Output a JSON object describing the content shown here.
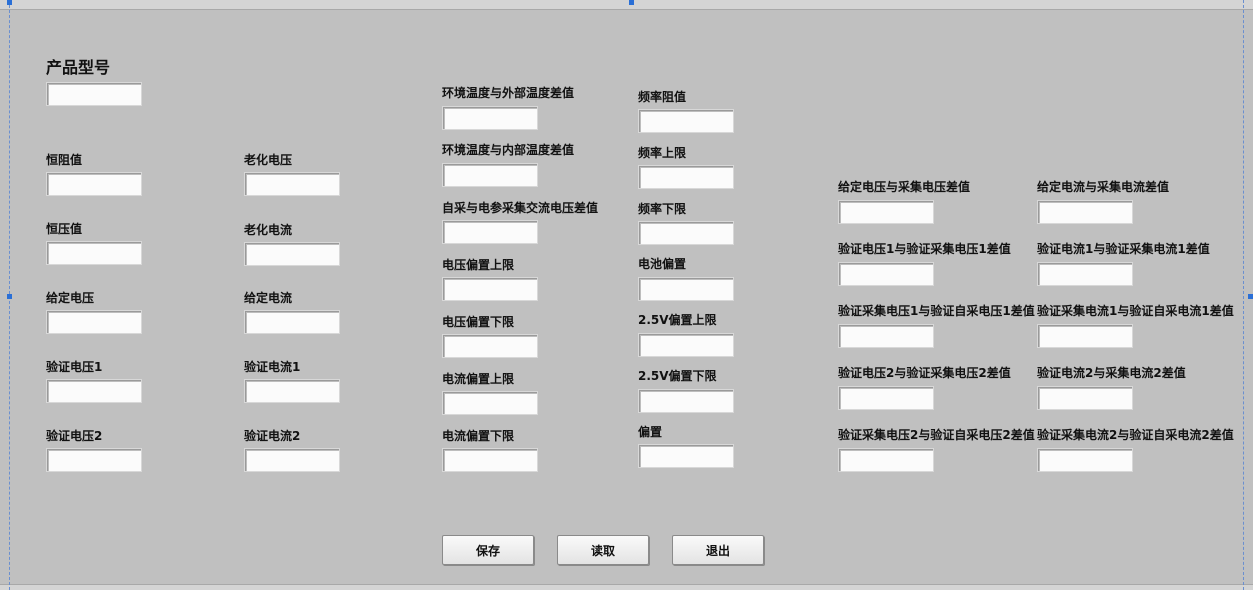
{
  "product_model": {
    "label": "产品型号",
    "value": ""
  },
  "left_fields": [
    {
      "label": "恒阻值",
      "value": ""
    },
    {
      "label": "老化电压",
      "value": ""
    },
    {
      "label": "恒压值",
      "value": ""
    },
    {
      "label": "老化电流",
      "value": ""
    },
    {
      "label": "给定电压",
      "value": ""
    },
    {
      "label": "给定电流",
      "value": ""
    },
    {
      "label": "验证电压1",
      "value": ""
    },
    {
      "label": "验证电流1",
      "value": ""
    },
    {
      "label": "验证电压2",
      "value": ""
    },
    {
      "label": "验证电流2",
      "value": ""
    }
  ],
  "mid_fields": [
    {
      "label": "环境温度与外部温度差值",
      "value": ""
    },
    {
      "label": "环境温度与内部温度差值",
      "value": ""
    },
    {
      "label": "自采与电参采集交流电压差值",
      "value": ""
    },
    {
      "label": "电压偏置上限",
      "value": ""
    },
    {
      "label": "电压偏置下限",
      "value": ""
    },
    {
      "label": "电流偏置上限",
      "value": ""
    },
    {
      "label": "电流偏置下限",
      "value": ""
    }
  ],
  "freq_fields": [
    {
      "label": "频率阻值",
      "value": ""
    },
    {
      "label": "频率上限",
      "value": ""
    },
    {
      "label": "频率下限",
      "value": ""
    },
    {
      "label": "电池偏置",
      "value": ""
    },
    {
      "label": "2.5V偏置上限",
      "value": ""
    },
    {
      "label": "2.5V偏置下限",
      "value": ""
    },
    {
      "label": "偏置",
      "value": ""
    }
  ],
  "right_fields": [
    {
      "label": "给定电压与采集电压差值",
      "value": ""
    },
    {
      "label": "给定电流与采集电流差值",
      "value": ""
    },
    {
      "label": "验证电压1与验证采集电压1差值",
      "value": ""
    },
    {
      "label": "验证电流1与验证采集电流1差值",
      "value": ""
    },
    {
      "label": "验证采集电压1与验证自采电压1差值",
      "value": ""
    },
    {
      "label": "验证采集电流1与验证自采电流1差值",
      "value": ""
    },
    {
      "label": "验证电压2与验证采集电压2差值",
      "value": ""
    },
    {
      "label": "验证电流2与采集电流2差值",
      "value": ""
    },
    {
      "label": "验证采集电压2与验证自采电压2差值",
      "value": ""
    },
    {
      "label": "验证采集电流2与验证自采电流2差值",
      "value": ""
    }
  ],
  "buttons": {
    "save": "保存",
    "read": "读取",
    "exit": "退出"
  }
}
